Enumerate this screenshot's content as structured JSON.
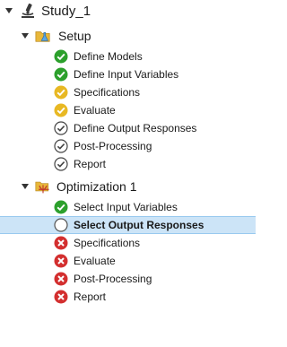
{
  "tree": {
    "study": {
      "label": "Study_1",
      "icon": "microscope-icon"
    },
    "setup": {
      "label": "Setup",
      "icon": "folder-flask-icon",
      "items": [
        {
          "label": "Define Models",
          "status": "done"
        },
        {
          "label": "Define Input Variables",
          "status": "done"
        },
        {
          "label": "Specifications",
          "status": "warning"
        },
        {
          "label": "Evaluate",
          "status": "warning"
        },
        {
          "label": "Define Output Responses",
          "status": "pending-check"
        },
        {
          "label": "Post-Processing",
          "status": "pending-check"
        },
        {
          "label": "Report",
          "status": "pending-check"
        }
      ]
    },
    "optimization": {
      "label": "Optimization 1",
      "icon": "folder-optimization-icon",
      "items": [
        {
          "label": "Select Input Variables",
          "status": "done"
        },
        {
          "label": "Select Output Responses",
          "status": "current",
          "selected": true
        },
        {
          "label": "Specifications",
          "status": "error"
        },
        {
          "label": "Evaluate",
          "status": "error"
        },
        {
          "label": "Post-Processing",
          "status": "error"
        },
        {
          "label": "Report",
          "status": "error"
        }
      ]
    }
  },
  "colors": {
    "done": "#2ca02c",
    "warning": "#e8b823",
    "error": "#d32f2f",
    "selected_bg": "#cce4f7"
  }
}
